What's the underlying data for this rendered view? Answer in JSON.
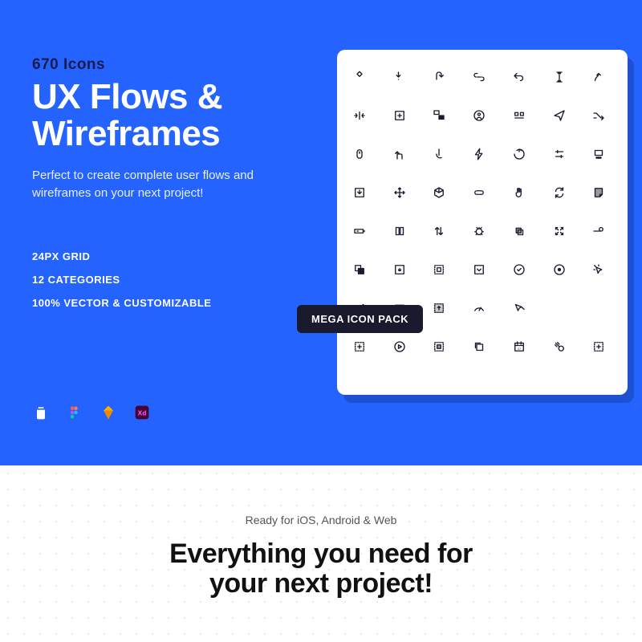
{
  "hero": {
    "eyebrow": "670 Icons",
    "title_line1": "UX Flows &",
    "title_line2": "Wireframes",
    "subtitle": "Perfect to create complete user flows and wireframes on your next project!",
    "features": [
      "24PX GRID",
      "12 CATEGORIES",
      "100% VECTOR & CUSTOMIZABLE"
    ],
    "badge": "MEGA ICON PACK"
  },
  "tools": [
    {
      "name": "iconjar",
      "color": "#ffffff"
    },
    {
      "name": "figma",
      "color": "#ff5e3a"
    },
    {
      "name": "sketch",
      "color": "#fdb300"
    },
    {
      "name": "adobe-xd",
      "color": "#ff2bc2"
    }
  ],
  "icon_grid_count": 56,
  "section2": {
    "eyebrow": "Ready for iOS, Android & Web",
    "title_line1": "Everything you need for",
    "title_line2": "your next project!"
  },
  "colors": {
    "primary": "#2563ff",
    "dark": "#1a1a2e"
  }
}
